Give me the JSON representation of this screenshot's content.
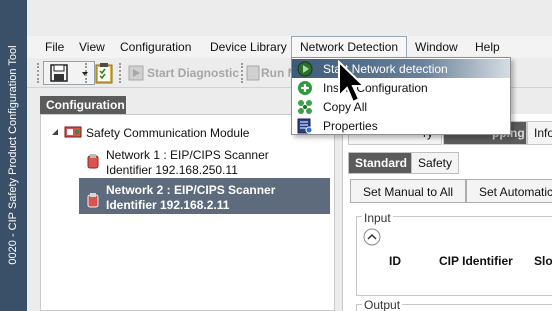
{
  "app": {
    "side_title": "0020 - CIP Safety Product Configuration Tool"
  },
  "menubar": {
    "items": [
      "File",
      "View",
      "Configuration",
      "Device Library",
      "Network Detection",
      "Window",
      "Help"
    ]
  },
  "toolbar": {
    "start_diagnostic": "Start Diagnostic",
    "run": "Run M"
  },
  "network_menu": {
    "items": [
      {
        "label": "Start Network detection",
        "icon": "play-network-icon"
      },
      {
        "label": "Insert Configuration",
        "icon": "plus-circle-icon"
      },
      {
        "label": "Copy All",
        "icon": "copy-grid-icon"
      },
      {
        "label": "Properties",
        "icon": "properties-icon"
      }
    ]
  },
  "config_panel": {
    "header": "Configuration",
    "tree": {
      "root": "Safety Communication Module",
      "nodes": [
        {
          "line1": "Network 1 : EIP/CIPS Scanner",
          "line2": "Identifier 192.168.250.11",
          "selected": false
        },
        {
          "line1": "Network 2 : EIP/CIPS Scanner",
          "line2": "Identifier 192.168.2.11",
          "selected": true
        }
      ]
    }
  },
  "right_panel": {
    "top_tabs": [
      "ry",
      "pping",
      "Info"
    ],
    "sub_tabs": [
      "Standard",
      "Safety"
    ],
    "buttons": {
      "set_manual": "Set Manual to All",
      "set_auto": "Set Automatic"
    },
    "input_group": {
      "label": "Input",
      "columns": [
        "ID",
        "CIP Identifier",
        "Slo"
      ]
    },
    "output_group": {
      "label": "Output"
    }
  },
  "colors": {
    "side_strip": "#3a5068",
    "selection": "#5d6b7d",
    "menu_highlight": "#3c5a7a"
  }
}
